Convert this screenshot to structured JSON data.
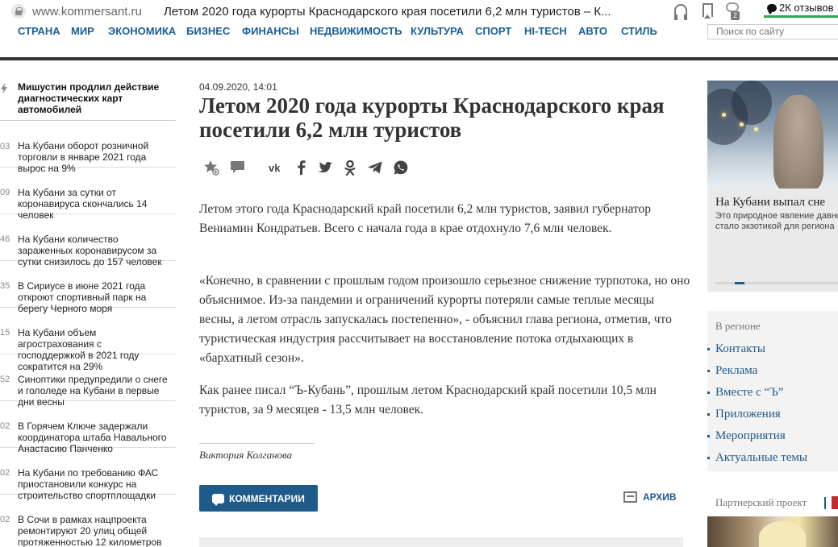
{
  "browser": {
    "url": "www.kommersant.ru",
    "tab_title": "Летом 2020 года курорты Краснодарского края посетили 6,2 млн туристов – К...",
    "comment_count": "2",
    "reviews_label": "2К отзывов"
  },
  "nav": {
    "items": [
      "СТРАНА",
      "МИР",
      "ЭКОНОМИКА",
      "БИЗНЕС",
      "ФИНАНСЫ",
      "НЕДВИЖИМОСТЬ",
      "КУЛЬТУРА",
      "СПОРТ",
      "HI-TECH",
      "АВТО",
      "СТИЛЬ"
    ],
    "search_placeholder": "Поиск по сайту"
  },
  "news": {
    "lead": "Мишустин продлил действие диагностических карт автомобилей",
    "items": [
      {
        "time": "03",
        "text": "На Кубани оборот розничной торговли в январе 2021 года вырос на 9%"
      },
      {
        "time": "09",
        "text": "На Кубани за сутки от коронавируса скончались 14 человек"
      },
      {
        "time": "46",
        "text": "На Кубани количество зараженных коронавирусом за сутки снизилось до 157 человек"
      },
      {
        "time": "35",
        "text": "В Сириусе в июне 2021 года откроют спортивный парк на берегу Черного моря"
      },
      {
        "time": "15",
        "text": "На Кубани объем агрострахования с господдержкой в 2021 году сократится на 29%"
      },
      {
        "time": "52",
        "text": "Синоптики предупредили о снеге и гололеде на Кубани в первые дни весны"
      },
      {
        "time": "02",
        "text": "В Горячем Ключе задержали координатора штаба Навального Анастасию Панченко"
      },
      {
        "time": "02",
        "text": "На Кубани по требованию ФАС приостановили конкурс на строительство спортплощадки"
      },
      {
        "time": "02",
        "text": "В Сочи в рамках нацпроекта ремонтируют 20 улиц общей протяженностью 12 километров"
      }
    ]
  },
  "article": {
    "date": "04.09.2020, 14:01",
    "title": "Летом 2020 года курорты Краснодарского края посетили 6,2 млн туристов",
    "paragraphs": [
      "Летом этого года Краснодарский край посетили 6,2 млн туристов, заявил губернатор Вениамин Кондратьев. Всего с начала года в крае отдохнуло 7,6 млн человек.",
      "«Конечно, в сравнении с прошлым годом произошло серьезное снижение турпотока, но оно объяснимое. Из-за пандемии и ограничений курорты потеряли самые теплые месяцы весны, а летом отрасль запускалась постепенно», - объяснил глава региона, отметив, что туристическая индустрия рассчитывает на восстановление потока отдыхающих в «бархатный сезон».",
      "Как ранее писал “Ъ-Кубань”, прошлым летом Краснодарский край посетили 10,5 млн туристов, за 9 месяцев - 13,5 млн человек."
    ],
    "author": "Виктория Колганова",
    "comments_button": "КОММЕНТАРИИ",
    "archive_label": "АРХИВ"
  },
  "sidebar": {
    "promo_title": "На Кубани выпал сне",
    "promo_subtitle": "Это природное явление давно стало экзотикой для региона",
    "promo_progress": 0.08,
    "region_heading": "В регионе",
    "region_links": [
      "Контакты",
      "Реклама",
      "Вместе с “Ъ”",
      "Приложения",
      "Мероприятия",
      "Актуальные темы"
    ],
    "partner_label": "Партнерский проект"
  },
  "colors": {
    "brand_blue": "#1e5a8a",
    "nav_blue": "#1a5d96",
    "reviews_green": "#2fa84f"
  }
}
